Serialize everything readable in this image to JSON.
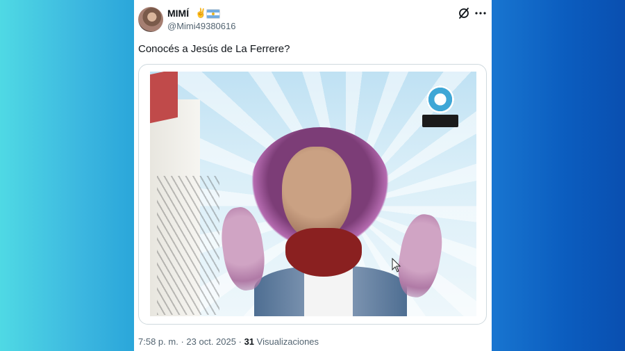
{
  "tweet": {
    "display_name": "MIMÍ",
    "emoji": "✌",
    "handle": "@Mimi49380616",
    "text": "Conocés a Jesús de La Ferrere?",
    "time": "7:58 p. m.",
    "separator": "·",
    "date": "23 oct. 2025",
    "views_count": "31",
    "views_label": "Visualizaciones"
  },
  "icons": {
    "grok": "grok-icon",
    "more": "more-dots-icon",
    "flag": "argentina-flag-icon"
  },
  "colors": {
    "text_primary": "#0f1419",
    "text_secondary": "#536471",
    "left_bg": "#3cb7e0",
    "right_bg": "#0b5dbf"
  }
}
